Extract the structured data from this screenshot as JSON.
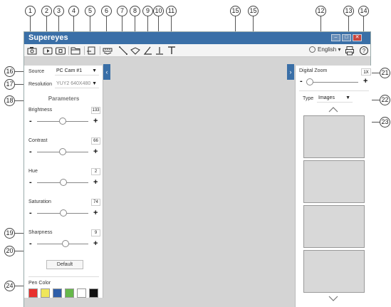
{
  "callouts": [
    "1",
    "2",
    "3",
    "4",
    "5",
    "6",
    "7",
    "8",
    "9",
    "10",
    "11",
    "12",
    "13",
    "14",
    "15",
    "15",
    "16",
    "17",
    "18",
    "19",
    "20",
    "21",
    "22",
    "23",
    "24"
  ],
  "window": {
    "title": "Supereyes",
    "language": "English"
  },
  "toolbar": {
    "icons": [
      "camera-icon",
      "record-icon",
      "video-icon",
      "folder-icon",
      "exit-icon",
      "measure-icon",
      "line-icon",
      "arc-icon",
      "angle-icon",
      "vertical-icon",
      "text-icon",
      "globe-icon",
      "print-icon",
      "help-icon"
    ]
  },
  "left_panel": {
    "source_label": "Source",
    "source_value": "PC Cam #1",
    "resolution_label": "Resolution",
    "resolution_value": "YUY2 640X480",
    "parameters_title": "Parameters",
    "params": [
      {
        "name": "Brightness",
        "value": "133",
        "level": 0.5
      },
      {
        "name": "Contrast",
        "value": "66",
        "level": 0.5
      },
      {
        "name": "Hue",
        "value": "2",
        "level": 0.52
      },
      {
        "name": "Saturation",
        "value": "74",
        "level": 0.52
      },
      {
        "name": "Sharpness",
        "value": "9",
        "level": 0.55
      }
    ],
    "minus": "-",
    "plus": "+",
    "default_label": "Default",
    "pen_color_label": "Pen Color",
    "pen_colors": [
      "#e8302c",
      "#efe65a",
      "#2e5ea9",
      "#66b84a",
      "#ffffff",
      "#111111"
    ]
  },
  "right_panel": {
    "digital_zoom_label": "Digital Zoom",
    "zoom_value": "1X",
    "zoom_level": 0.05,
    "minus": "-",
    "plus": "+",
    "type_label": "Type",
    "type_value": "Images"
  },
  "colors": {
    "titlebar": "#3a6fa7",
    "canvas": "#d4d4d4",
    "accent": "#3a6fa7"
  }
}
